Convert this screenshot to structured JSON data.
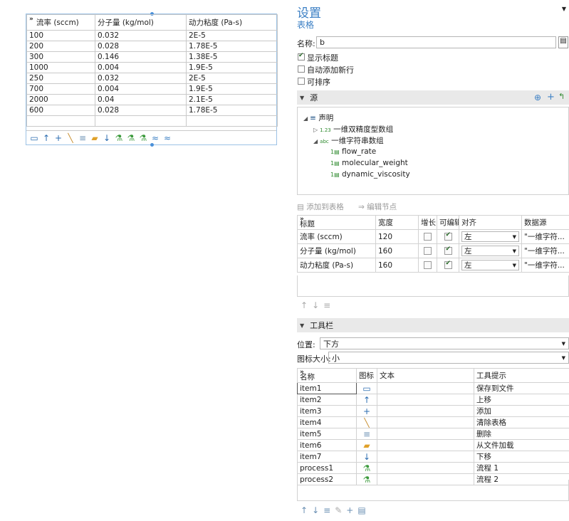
{
  "left_table": {
    "columns": [
      "流率 (sccm)",
      "分子量 (kg/mol)",
      "动力粘度 (Pa-s)"
    ],
    "rows": [
      [
        "100",
        "0.032",
        "2E-5"
      ],
      [
        "200",
        "0.028",
        "1.78E-5"
      ],
      [
        "300",
        "0.146",
        "1.38E-5"
      ],
      [
        "1000",
        "0.004",
        "1.9E-5"
      ],
      [
        "250",
        "0.032",
        "2E-5"
      ],
      [
        "700",
        "0.004",
        "1.9E-5"
      ],
      [
        "2000",
        "0.04",
        "2.1E-5"
      ],
      [
        "600",
        "0.028",
        "1.78E-5"
      ]
    ],
    "toolbar_icons": [
      "save-icon",
      "arrow-up-icon",
      "plus-icon",
      "brush-icon",
      "delete-rows-icon",
      "folder-open-icon",
      "arrow-down-icon",
      "flask-icon",
      "flask-icon",
      "flask-icon",
      "wave-icon",
      "wave-icon"
    ]
  },
  "panel": {
    "title": "设置",
    "subtitle": "表格",
    "name_label": "名称:",
    "name_value": "b",
    "checkboxes": [
      {
        "label": "显示标题",
        "checked": true
      },
      {
        "label": "自动添加新行",
        "checked": false
      },
      {
        "label": "可排序",
        "checked": false
      }
    ],
    "source_section": "源",
    "tree": {
      "root": "声明",
      "n1": "一维双精度型数组",
      "n2": "一维字符串数组",
      "leaf1": "flow_rate",
      "leaf2": "molecular_weight",
      "leaf3": "dynamic_viscosity"
    },
    "add_to_table": "添加到表格",
    "edit_node": "编辑节点",
    "col_grid": {
      "headers": [
        "标题",
        "宽度",
        "增长",
        "可编辑",
        "对齐",
        "数据源"
      ],
      "rows": [
        {
          "title": "流率 (sccm)",
          "width": "120",
          "grow": false,
          "editable": true,
          "align": "左",
          "source": "\"一维字符..."
        },
        {
          "title": "分子量 (kg/mol)",
          "width": "160",
          "grow": false,
          "editable": true,
          "align": "左",
          "source": "\"一维字符..."
        },
        {
          "title": "动力粘度 (Pa-s)",
          "width": "160",
          "grow": false,
          "editable": true,
          "align": "左",
          "source": "\"一维字符..."
        }
      ]
    },
    "toolbar_section": "工具栏",
    "position_label": "位置:",
    "position_value": "下方",
    "icon_size_label": "图标大小:",
    "icon_size_value": "小",
    "tool_grid": {
      "headers": [
        "名称",
        "图标",
        "文本",
        "工具提示"
      ],
      "rows": [
        {
          "name": "item1",
          "icon": "save-icon",
          "text": "",
          "tip": "保存到文件"
        },
        {
          "name": "item2",
          "icon": "arrow-up-icon",
          "text": "",
          "tip": "上移"
        },
        {
          "name": "item3",
          "icon": "plus-icon",
          "text": "",
          "tip": "添加"
        },
        {
          "name": "item4",
          "icon": "brush-icon",
          "text": "",
          "tip": "清除表格"
        },
        {
          "name": "item5",
          "icon": "delete-rows-icon",
          "text": "",
          "tip": "删除"
        },
        {
          "name": "item6",
          "icon": "folder-open-icon",
          "text": "",
          "tip": "从文件加载"
        },
        {
          "name": "item7",
          "icon": "arrow-down-icon",
          "text": "",
          "tip": "下移"
        },
        {
          "name": "process1",
          "icon": "flask-icon",
          "text": "",
          "tip": "流程 1"
        },
        {
          "name": "process2",
          "icon": "flask-icon",
          "text": "",
          "tip": "流程 2"
        }
      ]
    }
  },
  "colors": {
    "accent": "#3b7fc4",
    "section_bg": "#e9e9e9",
    "selection": "#4a90d9"
  }
}
